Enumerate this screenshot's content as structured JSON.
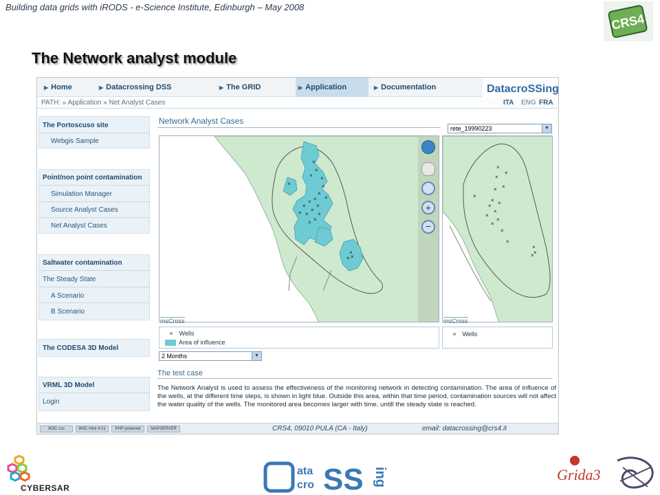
{
  "slide": {
    "header": "Building data grids with iRODS - e-Science Institute, Edinburgh – May 2008",
    "title": "The Network analyst module"
  },
  "nav": {
    "items": [
      {
        "label": "Home"
      },
      {
        "label": "Datacrossing DSS"
      },
      {
        "label": "The GRID"
      },
      {
        "label": "Application"
      },
      {
        "label": "Documentation"
      }
    ],
    "brand_text": "DatacroSSing"
  },
  "path": {
    "text": "PATH: » Application » Net Analyst Cases",
    "languages": [
      "ITA",
      "ENG",
      "FRA"
    ]
  },
  "sidebar": {
    "sections": [
      {
        "heading": "The Portoscuso site",
        "items": [
          "Webgis Sample"
        ]
      },
      {
        "heading": "Point/non point contamination",
        "items": [
          "Simulation Manager",
          "Source Analyst Cases",
          "Net Analyst Cases"
        ]
      },
      {
        "heading": "Saltwater contamination",
        "items": [
          "The Steady State",
          "A Scenario",
          "B Scenario"
        ]
      },
      {
        "heading": "The CODESA 3D Model",
        "items": []
      },
      {
        "heading": "VRML 3D Model",
        "items": [
          "Login"
        ]
      }
    ]
  },
  "main": {
    "title": "Network Analyst Cases",
    "network_select": "rete_19990223",
    "map_label": "msCross",
    "overview_label": "msCross",
    "legend": {
      "wells": "Wells",
      "influence": "Area of influence"
    },
    "overview_legend": {
      "wells": "Wells"
    },
    "time_select": "2 Months",
    "test_case_title": "The test case",
    "test_case_text": "The Network Analyst is used to assess the effectiveness of the monitoring network in detecting contamination. The area of influence of the wells, at the different time steps, is shown in light blue. Outside this area, within that time period, contamination sources will not affect the water quality of the wells. The monitored area becomes larger with time, untill the steady state is reached."
  },
  "footer": {
    "badges": [
      "W3C css",
      "W3C html 4.01",
      "PHP powered",
      "MAPSERVER"
    ],
    "address": "CRS4, 09010 PULA (CA - Italy)",
    "email": "email: datacrossing@crs4.it"
  },
  "logos": {
    "crs4": "CRS4",
    "cybersar": "CYBERSAR",
    "grida3": "Grida3"
  },
  "colors": {
    "land": "#cfe9cf",
    "influence": "#6fcbd3",
    "nav_active": "#c9dcec",
    "sidebar_bg": "#eaf2f8"
  }
}
